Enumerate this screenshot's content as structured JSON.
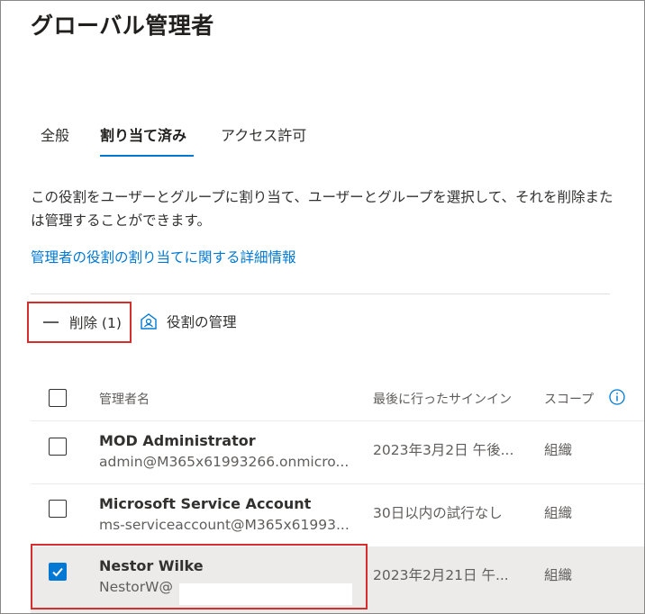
{
  "page": {
    "title": "グローバル管理者"
  },
  "tabs": [
    {
      "label": "全般",
      "active": false
    },
    {
      "label": "割り当て済み",
      "active": true
    },
    {
      "label": "アクセス許可",
      "active": false
    }
  ],
  "description": "この役割をユーザーとグループに割り当て、ユーザーとグループを選択して、それを削除または管理することができます。",
  "learn_more_link": "管理者の役割の割り当てに関する詳細情報",
  "toolbar": {
    "remove_label": "削除 (1)",
    "manage_label": "役割の管理"
  },
  "table": {
    "headers": {
      "name": "管理者名",
      "last_signin": "最後に行ったサインイン",
      "scope": "スコープ"
    },
    "rows": [
      {
        "name": "MOD Administrator",
        "email": "admin@M365x61993266.onmicro...",
        "last_signin": "2023年3月2日 午後...",
        "scope": "組織",
        "checked": false
      },
      {
        "name": "Microsoft Service Account",
        "email": "ms-serviceaccount@M365x61993...",
        "last_signin": "30日以内の試行なし",
        "scope": "組織",
        "checked": false
      },
      {
        "name": "Nestor Wilke",
        "email": "NestorW@",
        "last_signin": "2023年2月21日 午...",
        "scope": "組織",
        "checked": true
      }
    ]
  },
  "colors": {
    "accent": "#0078d4",
    "highlight_border": "#d62d2d",
    "selected_row": "#edebe9"
  }
}
